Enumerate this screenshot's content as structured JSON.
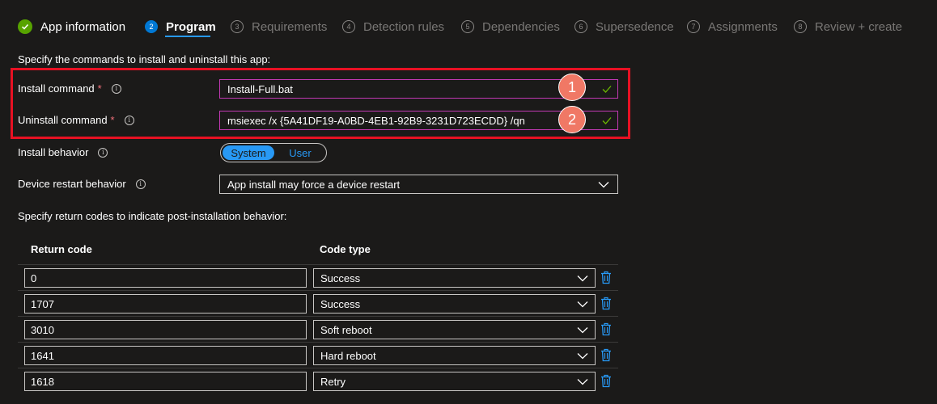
{
  "steps": [
    {
      "number": "✓",
      "label": "App information",
      "state": "done"
    },
    {
      "number": "2",
      "label": "Program",
      "state": "active"
    },
    {
      "number": "3",
      "label": "Requirements",
      "state": "pending"
    },
    {
      "number": "4",
      "label": "Detection rules",
      "state": "pending"
    },
    {
      "number": "5",
      "label": "Dependencies",
      "state": "pending"
    },
    {
      "number": "6",
      "label": "Supersedence",
      "state": "pending"
    },
    {
      "number": "7",
      "label": "Assignments",
      "state": "pending"
    },
    {
      "number": "8",
      "label": "Review + create",
      "state": "pending"
    }
  ],
  "form": {
    "intro": "Specify the commands to install and uninstall this app:",
    "install_command": {
      "label": "Install command",
      "required_mark": "*",
      "value": "Install-Full.bat"
    },
    "uninstall_command": {
      "label": "Uninstall command",
      "required_mark": "*",
      "value": "msiexec /x {5A41DF19-A0BD-4EB1-92B9-3231D723ECDD} /qn"
    },
    "install_behavior": {
      "label": "Install behavior",
      "options": [
        "System",
        "User"
      ],
      "selected": "System"
    },
    "device_restart": {
      "label": "Device restart behavior",
      "value": "App install may force a device restart"
    },
    "info_glyph": "i"
  },
  "annotations": {
    "badge1": "1",
    "badge2": "2"
  },
  "return_codes": {
    "intro": "Specify return codes to indicate post-installation behavior:",
    "headers": {
      "code": "Return code",
      "type": "Code type"
    },
    "rows": [
      {
        "code": "0",
        "type": "Success"
      },
      {
        "code": "1707",
        "type": "Success"
      },
      {
        "code": "3010",
        "type": "Soft reboot"
      },
      {
        "code": "1641",
        "type": "Hard reboot"
      },
      {
        "code": "1618",
        "type": "Retry"
      }
    ]
  },
  "colors": {
    "background": "#1b1a19",
    "accent": "#2899f5",
    "done": "#57a300",
    "highlight": "#e81123",
    "badge": "#f07865",
    "field_border": "#c239b3"
  },
  "icons": {
    "check": "check-icon",
    "chevron": "chevron-down-icon",
    "trash": "trash-icon",
    "info": "info-icon"
  }
}
